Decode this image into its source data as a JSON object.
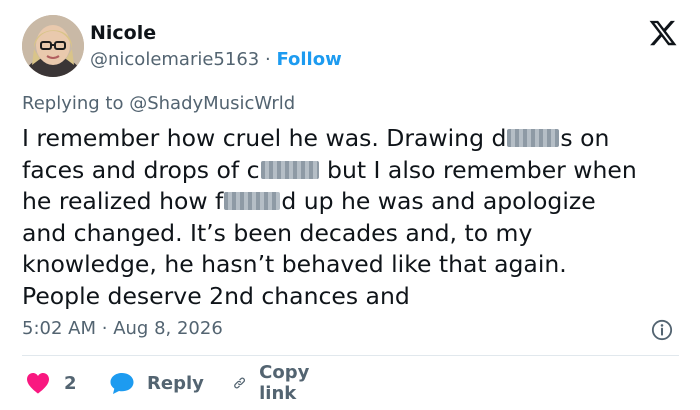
{
  "author": {
    "name": "Nicole",
    "handle": "@nicolemarie5163",
    "separator": "·",
    "follow_label": "Follow"
  },
  "reply_context": {
    "prefix": "Replying to",
    "handle": "@ShadyMusicWrld"
  },
  "tweet": {
    "lines": [
      {
        "a": "I remember how cruel he was. Drawing d",
        "b": "s on"
      },
      {
        "a": "faces and drops of c",
        "b": " but I also remember when"
      },
      {
        "a": "he realized how f",
        "b": "d up he was and apologize"
      },
      {
        "a": "and changed. It’s been decades and, to my",
        "b": ""
      },
      {
        "a": "knowledge, he hasn’t behaved like that again.",
        "b": ""
      },
      {
        "a": "People deserve 2nd chances and",
        "b": ""
      }
    ]
  },
  "meta": {
    "time": "5:02 AM",
    "separator": "·",
    "date": "Aug 8, 2026"
  },
  "actions": {
    "like_count": "2",
    "reply_label": "Reply",
    "copy_label": "Copy link"
  },
  "colors": {
    "text": "#0f1419",
    "secondary": "#536471",
    "accent": "#1d9bf0",
    "like": "#f91880"
  },
  "icons": [
    "x-logo-icon",
    "info-icon",
    "heart-icon",
    "reply-bubble-icon",
    "link-icon"
  ]
}
